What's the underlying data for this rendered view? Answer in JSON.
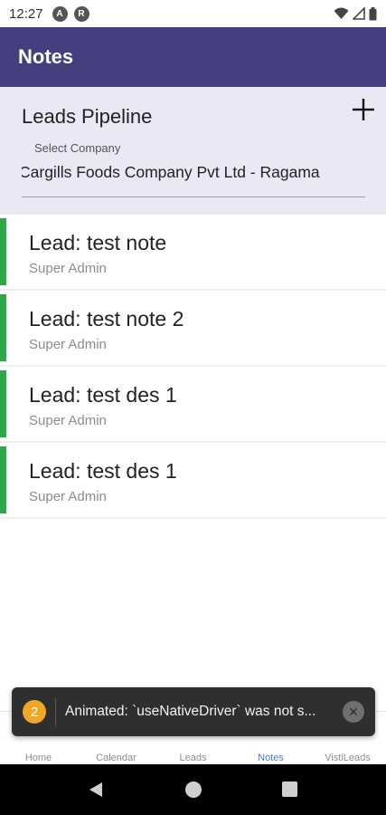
{
  "status_bar": {
    "time": "12:27",
    "icon1": "A",
    "icon2": "R"
  },
  "app_bar": {
    "title": "Notes"
  },
  "header": {
    "title": "Leads Pipeline",
    "add_icon": "plus-icon",
    "company_label": "Select Company",
    "company_value": "Cargills Foods Company Pvt Ltd - Ragama"
  },
  "notes": [
    {
      "title": "Lead: test note",
      "author": "Super Admin"
    },
    {
      "title": "Lead: test note 2",
      "author": "Super Admin"
    },
    {
      "title": "Lead: test des 1",
      "author": "Super Admin"
    },
    {
      "title": "Lead: test des 1",
      "author": "Super Admin"
    }
  ],
  "tabs": [
    {
      "label": "Home",
      "icon": "home-icon"
    },
    {
      "label": "Calendar",
      "icon": "calendar-icon"
    },
    {
      "label": "Leads",
      "icon": "leads-icon"
    },
    {
      "label": "Notes",
      "icon": "notes-icon",
      "active": true
    },
    {
      "label": "VistiLeads",
      "icon": "visit-leads-icon"
    }
  ],
  "toast": {
    "badge": "2",
    "message": "Animated: `useNativeDriver` was not s..."
  },
  "colors": {
    "primary": "#463f7f",
    "accent_green": "#2fa84a",
    "active_tab": "#4a7fd0",
    "header_bg": "#e9e8f4"
  }
}
